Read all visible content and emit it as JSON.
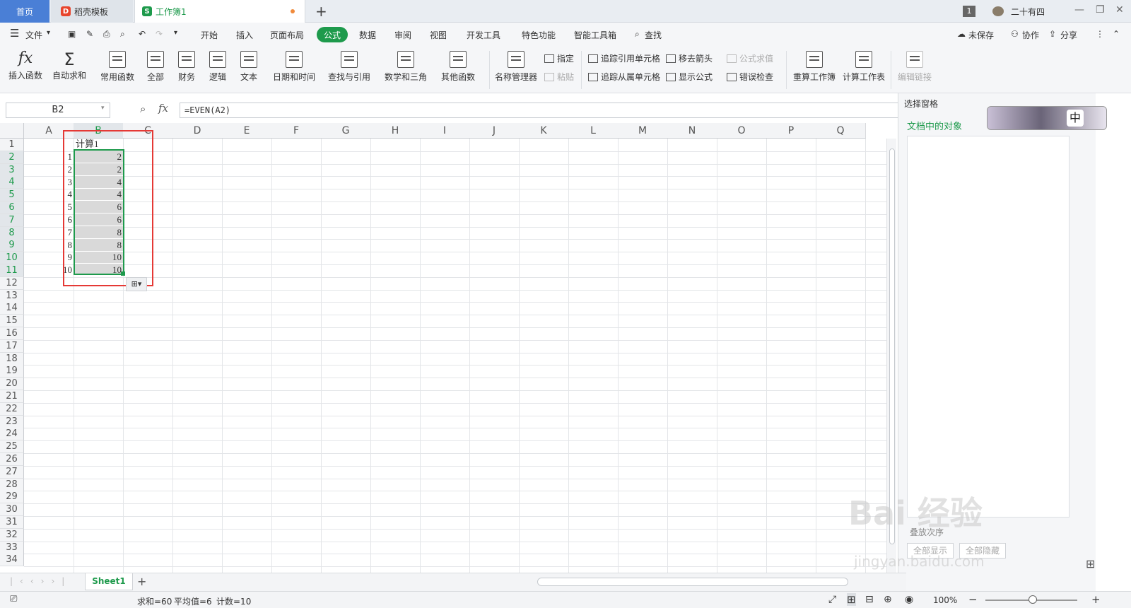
{
  "tabs": {
    "home": "首页",
    "template": "稻壳模板",
    "workbook": "工作簿1",
    "new_tab": "+"
  },
  "title_right": {
    "badge": "1",
    "user": "二十有四"
  },
  "menu": {
    "file": "文件",
    "items": [
      "开始",
      "插入",
      "页面布局",
      "公式",
      "数据",
      "审阅",
      "视图",
      "开发工具",
      "特色功能",
      "智能工具箱",
      "查找"
    ],
    "active": "公式",
    "unsaved": "未保存",
    "collab": "协作",
    "share": "分享"
  },
  "ribbon": {
    "insert_fn": "插入函数",
    "autosum": "自动求和",
    "common": "常用函数",
    "all": "全部",
    "finance": "财务",
    "logic": "逻辑",
    "text": "文本",
    "datetime": "日期和时间",
    "lookup": "查找与引用",
    "math": "数学和三角",
    "other": "其他函数",
    "name_mgr": "名称管理器",
    "specify": "指定",
    "paste": "粘贴",
    "trace_prec": "追踪引用单元格",
    "trace_dep": "追踪从属单元格",
    "remove_arrows": "移去箭头",
    "show_formula": "显示公式",
    "eval_formula": "公式求值",
    "error_check": "错误检查",
    "recalc_book": "重算工作簿",
    "calc_sheet": "计算工作表",
    "edit_links": "编辑链接"
  },
  "formula_bar": {
    "name_box": "B2",
    "fx": "fx",
    "formula": "=EVEN(A2)"
  },
  "columns": [
    "A",
    "B",
    "C",
    "D",
    "E",
    "F",
    "G",
    "H",
    "I",
    "J",
    "K",
    "L",
    "M",
    "N",
    "O",
    "P",
    "Q"
  ],
  "rows": [
    "1",
    "2",
    "3",
    "4",
    "5",
    "6",
    "7",
    "8",
    "9",
    "10",
    "11",
    "12",
    "13",
    "14",
    "15",
    "16",
    "17",
    "18",
    "19",
    "20",
    "21",
    "22",
    "23",
    "24",
    "25",
    "26",
    "27",
    "28",
    "29",
    "30",
    "31",
    "32",
    "33",
    "34"
  ],
  "cells": {
    "b1": "计算1",
    "a": [
      "1",
      "2",
      "3",
      "4",
      "5",
      "6",
      "7",
      "8",
      "9",
      "10"
    ],
    "b": [
      "2",
      "2",
      "4",
      "4",
      "6",
      "6",
      "8",
      "8",
      "10",
      "10"
    ]
  },
  "side_panel": {
    "title": "选择窗格",
    "objects": "文档中的对象",
    "ime": "中",
    "show_all": "全部显示",
    "hide_all": "全部隐藏",
    "order": "叠放次序"
  },
  "sheet": {
    "name": "Sheet1",
    "add": "+"
  },
  "status": {
    "sum": "求和=60",
    "avg": "平均值=6",
    "count": "计数=10",
    "zoom": "100%"
  },
  "watermark": {
    "text": "Bai 经验",
    "url": "jingyan.baidu.com"
  },
  "colors": {
    "accent": "#1e9a4c",
    "home_tab": "#4a7fd6",
    "highlight": "#e53935"
  }
}
